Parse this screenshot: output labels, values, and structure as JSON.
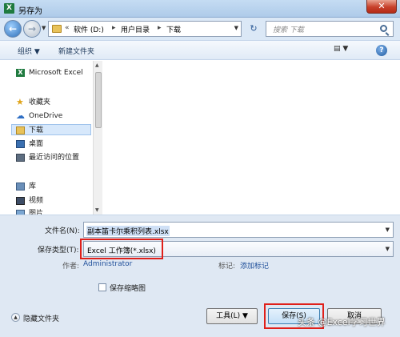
{
  "window": {
    "title": "另存为",
    "app_icon_letter": "X",
    "close_glyph": "✕"
  },
  "nav": {
    "back_glyph": "←",
    "forward_glyph": "→",
    "dropdown_glyph": "▼",
    "breadcrumb_prefix": "«",
    "breadcrumb": [
      "软件 (D:)",
      "用户目录",
      "下载"
    ],
    "separator": "▸",
    "refresh_glyph": "↻",
    "search_placeholder": "搜索 下载"
  },
  "toolbar": {
    "organize": "组织 ▼",
    "new_folder": "新建文件夹",
    "view_glyph": "▤ ▼",
    "help_glyph": "?"
  },
  "sidebar": {
    "items": [
      {
        "label": "Microsoft Excel",
        "icon": "excel-icon"
      },
      {
        "label": "收藏夹",
        "icon": "star-icon"
      },
      {
        "label": "OneDrive",
        "icon": "cloud-icon"
      },
      {
        "label": "下载",
        "icon": "folder-icon"
      },
      {
        "label": "桌面",
        "icon": "desktop-icon"
      },
      {
        "label": "最近访问的位置",
        "icon": "recent-icon"
      },
      {
        "label": "库",
        "icon": "library-icon"
      },
      {
        "label": "视频",
        "icon": "video-icon"
      },
      {
        "label": "图片",
        "icon": "picture-icon"
      }
    ]
  },
  "form": {
    "filename_label": "文件名(N):",
    "filename_value": "副本笛卡尔乘积列表.xlsx",
    "filetype_label": "保存类型(T):",
    "filetype_value": "Excel 工作簿(*.xlsx)",
    "author_label": "作者:",
    "author_value": "Administrator",
    "tags_label": "标记:",
    "tags_value": "添加标记",
    "thumbnail_label": "保存缩略图"
  },
  "footer": {
    "hide_folders": "隐藏文件夹",
    "tools": "工具(L)",
    "save": "保存(S)",
    "cancel": "取消"
  },
  "watermark": "头条 @Excel学习世界",
  "colors": {
    "highlight_red": "#e0201a",
    "link_blue": "#1f4f9a",
    "title_bar": "#c5dcf3"
  }
}
